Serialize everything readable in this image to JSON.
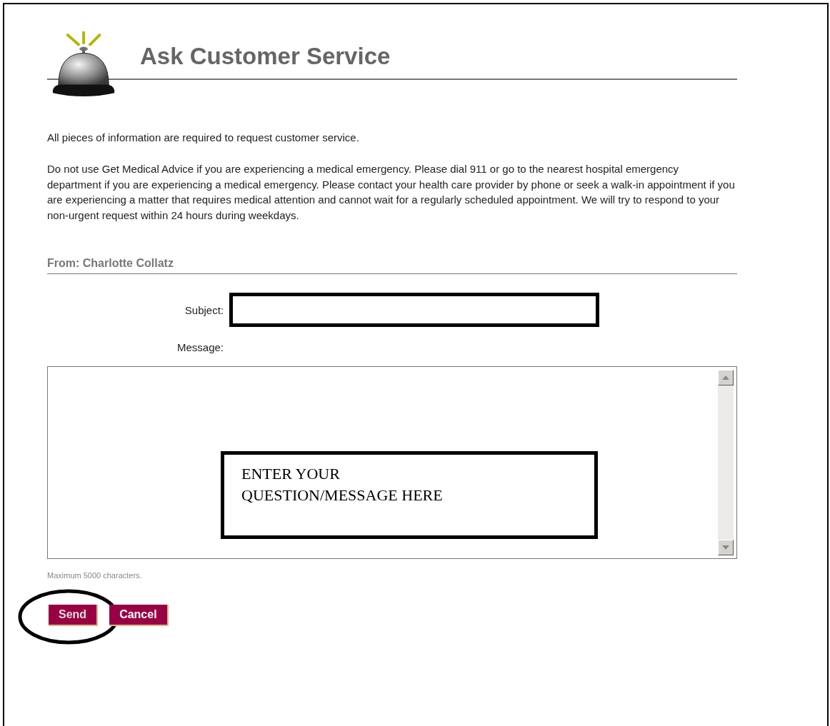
{
  "header": {
    "title": "Ask Customer Service"
  },
  "intro": "All pieces of information are required to request customer service.",
  "notice": "Do not use Get Medical Advice if you are experiencing a medical emergency. Please dial 911 or go to the nearest hospital emergency department if you are experiencing a medical emergency. Please contact your health care provider by phone or seek a walk-in appointment if you are experiencing a matter that requires medical attention and cannot wait for a regularly scheduled appointment. We will try to respond to your non-urgent request within 24 hours during weekdays.",
  "from": "From: Charlotte Collatz",
  "subject": {
    "label": "Subject:",
    "highlighted": true
  },
  "message": {
    "label": "Message:"
  },
  "note": "Maximum 5000 characters.",
  "buttons": [
    {
      "label": "Send",
      "circled": true
    },
    {
      "label": "Cancel",
      "circled": false
    }
  ],
  "callout": {
    "lines": [
      "ENTER YOUR",
      "QUESTION/MESSAGE HERE"
    ]
  }
}
